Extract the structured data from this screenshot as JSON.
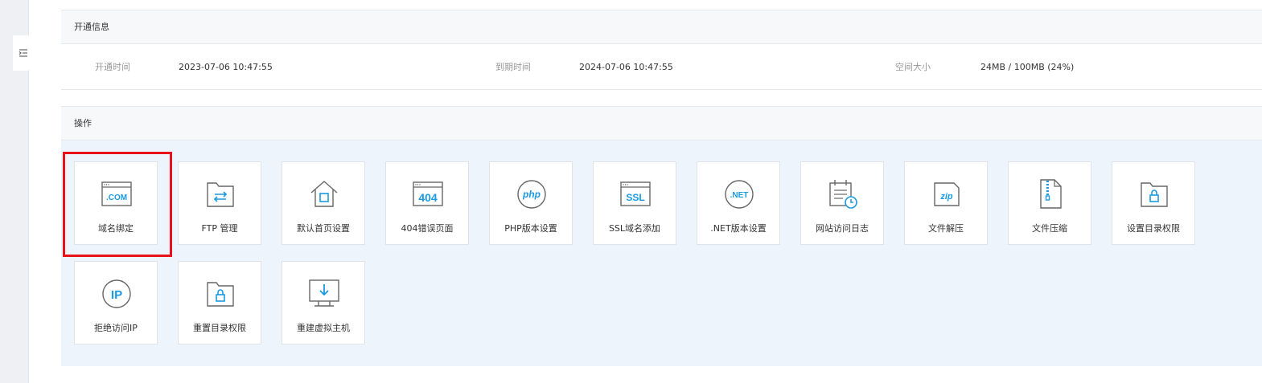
{
  "info": {
    "title": "开通信息",
    "open_time_label": "开通时间",
    "open_time_value": "2023-07-06 10:47:55",
    "expire_label": "到期时间",
    "expire_value": "2024-07-06 10:47:55",
    "space_label": "空间大小",
    "space_value": "24MB / 100MB (24%)"
  },
  "ops": {
    "title": "操作",
    "tiles": [
      {
        "label": "域名绑定",
        "icon": "domain-com-icon"
      },
      {
        "label": "FTP 管理",
        "icon": "ftp-folder-icon"
      },
      {
        "label": "默认首页设置",
        "icon": "home-icon"
      },
      {
        "label": "404错误页面",
        "icon": "error-404-icon"
      },
      {
        "label": "PHP版本设置",
        "icon": "php-icon"
      },
      {
        "label": "SSL域名添加",
        "icon": "ssl-icon"
      },
      {
        "label": ".NET版本设置",
        "icon": "dotnet-icon"
      },
      {
        "label": "网站访问日志",
        "icon": "access-log-icon"
      },
      {
        "label": "文件解压",
        "icon": "unzip-icon"
      },
      {
        "label": "文件压缩",
        "icon": "zip-file-icon"
      },
      {
        "label": "设置目录权限",
        "icon": "folder-lock-icon"
      },
      {
        "label": "拒绝访问IP",
        "icon": "ip-icon"
      },
      {
        "label": "重置目录权限",
        "icon": "folder-lock-reset-icon"
      },
      {
        "label": "重建虚拟主机",
        "icon": "rebuild-host-icon"
      }
    ]
  },
  "icon_texts": {
    "com": ".COM",
    "e404": "404",
    "php": "php",
    "ssl": "SSL",
    "net": ".NET",
    "zip": "zip",
    "ip": "IP"
  },
  "colors": {
    "accent": "#1a9ae0",
    "icon_stroke": "#666666",
    "highlight": "#e8121b",
    "ops_bg": "#edf4fb"
  }
}
